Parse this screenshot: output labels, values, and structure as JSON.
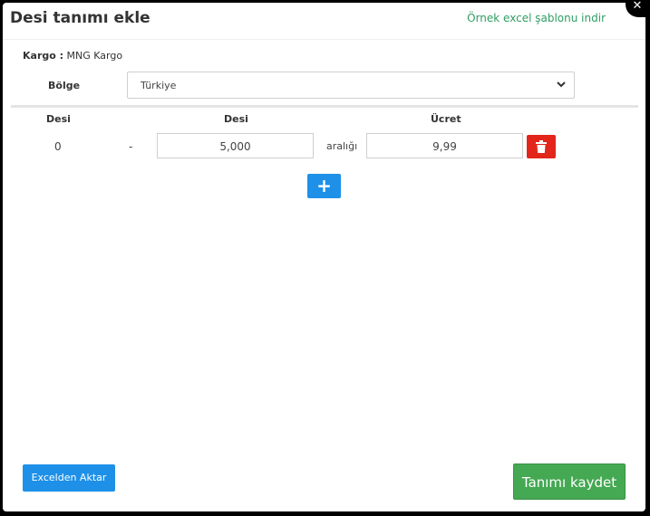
{
  "modal": {
    "title": "Desi tanımı ekle",
    "excel_template_link": "Örnek excel şablonu indir",
    "close_icon": "close-icon"
  },
  "cargo": {
    "label": "Kargo :",
    "value": "MNG Kargo"
  },
  "region": {
    "label": "Bölge",
    "selected": "Türkiye"
  },
  "table": {
    "headers": [
      "Desi",
      "Desi",
      "Ücret"
    ],
    "rows": [
      {
        "start": "0",
        "separator": "-",
        "end": "5,000",
        "range_word": "aralığı",
        "price": "9,99"
      }
    ]
  },
  "buttons": {
    "add_label": "+",
    "import_label": "Excelden Aktar",
    "save_label": "Tanımı kaydet",
    "delete_icon": "trash-icon"
  },
  "colors": {
    "link_green": "#2f9e63",
    "delete_red": "#e2261b",
    "primary_blue": "#1e90e8",
    "save_green": "#45a853"
  }
}
